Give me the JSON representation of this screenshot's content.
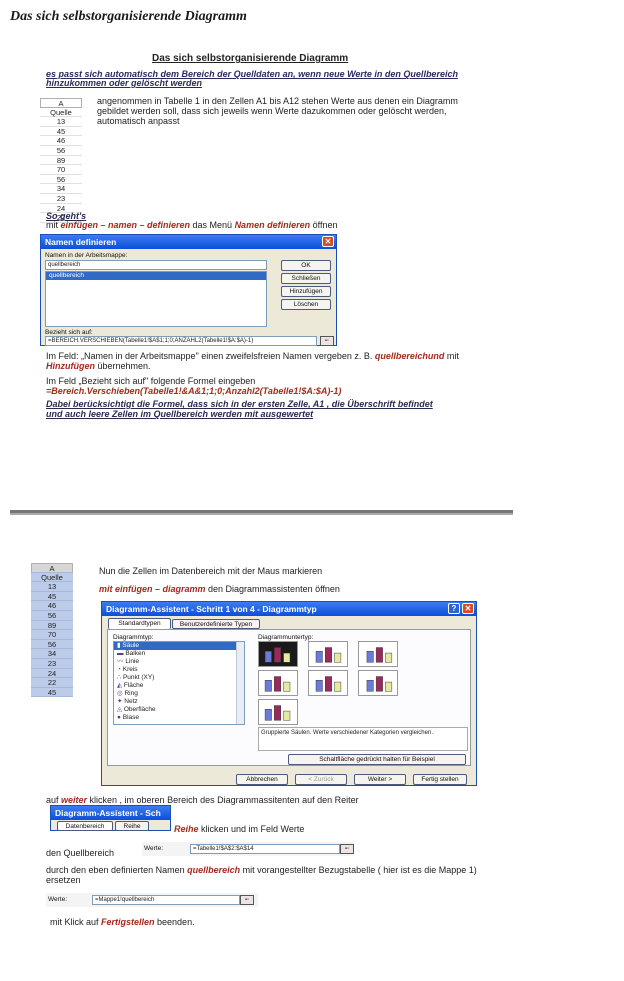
{
  "page_title": "Das sich selbstorganisierende Diagramm",
  "section_title": "Das sich selbstorganisierende Diagramm",
  "intro": "es passt sich automatisch dem Bereich der Quelldaten an, wenn neue Werte in den Quellbereich hinzukommen oder gelöscht werden",
  "sheet1": {
    "header": "A",
    "cells": [
      "Quelle",
      "13",
      "45",
      "46",
      "56",
      "89",
      "70",
      "56",
      "34",
      "23",
      "24",
      "22"
    ]
  },
  "sheet1_text": "angenommen in Tabelle 1 in den Zellen A1 bis A12 stehen Werte aus denen ein Diagramm gebildet werden soll, dass sich jeweils wenn  Werte dazukommen oder gelöscht werden, automatisch anpasst",
  "howto": {
    "heading": "So geht's",
    "pre": "mit ",
    "menu_path": "einfügen – namen – definieren",
    "mid": " das Menü ",
    "menu_name": "Namen definieren",
    "post": " öffnen"
  },
  "names_dialog": {
    "title": "Namen definieren",
    "label_names": "Namen in der Arbeitsmappe:",
    "name_value": "quellbereich",
    "list_items": [
      "quellbereich"
    ],
    "buttons": [
      "OK",
      "Schließen",
      "Hinzufügen",
      "Löschen"
    ],
    "label_ref": "Bezieht sich auf:",
    "ref_value": "=BEREICH.VERSCHIEBEN(Tabelle1!$A$1;1;0;ANZAHL2(Tabelle1!$A:$A)-1)"
  },
  "para1": {
    "text": "Im Feld: „Namen in der Arbeitsmappe\"  einen zweifelsfreien Namen vergeben z. B. ",
    "name": "quellbereichund",
    "mid": " mit ",
    "action": "Hinzufügen",
    "post": " übernehmen."
  },
  "para2": {
    "text": "Im Feld „Bezieht sich auf\" folgende Formel eingeben",
    "formula": "=Bereich.Verschieben(Tabelle1!&A&1;1;0;Anzahl2(Tabelle1!$A:$A)-1)"
  },
  "note": "Dabei berücksichtigt die Formel, dass sich in der ersten Zelle, A1 , die Überschrift befindet und auch leere Zellen im Quellbereich werden mit ausgewertet",
  "sheet2": {
    "header": "A",
    "cells": [
      "Quelle",
      "13",
      "45",
      "46",
      "56",
      "89",
      "70",
      "56",
      "34",
      "23",
      "24",
      "22",
      "45"
    ]
  },
  "step_mark": "Nun die Zellen im Datenbereich mit der Maus markieren",
  "step_open": {
    "path": "mit einfügen – diagramm",
    "text": " den Diagrammassistenten öffnen"
  },
  "wizard": {
    "title": "Diagramm-Assistent - Schritt 1 von 4 - Diagrammtyp",
    "tabs": [
      "Standardtypen",
      "Benutzerdefinierte Typen"
    ],
    "label_type": "Diagrammtyp:",
    "label_subtype": "Diagrammuntertyp:",
    "types": [
      "Säule",
      "Balken",
      "Linie",
      "Kreis",
      "Punkt (XY)",
      "Fläche",
      "Ring",
      "Netz",
      "Oberfläche",
      "Blase"
    ],
    "description": "Gruppierte Säulen. Werte verschiedener Kategorien vergleichen.",
    "preview_button": "Schaltfläche gedrückt halten für Beispiel",
    "buttons": [
      "Abbrechen",
      "< Zurück",
      "Weiter >",
      "Fertig stellen"
    ]
  },
  "step_weiter": {
    "pre": "auf ",
    "word": "weiter",
    "post": " klicken , im oberen Bereich des Diagrammassitenten auf den Reiter"
  },
  "mini_wizard": {
    "title": "Diagramm-Assistent - Sch",
    "tabs": [
      "Datenbereich",
      "Reihe"
    ]
  },
  "step_reihe": {
    "word": "Reihe",
    "post": " klicken und im Feld Werte"
  },
  "werte1": {
    "label": "Werte:",
    "value": "=Tabelle1!$A$2:$A$14",
    "prefix": "den Quellbereich"
  },
  "step_replace": {
    "pre": "durch den eben definierten Namen ",
    "name": "quellbereich",
    "post": " mit vorangestellter Bezugstabelle ( hier ist es die Mappe 1) ersetzen"
  },
  "werte2": {
    "label": "Werte:",
    "value": "=Mappe1!quellbereich"
  },
  "step_finish": {
    "pre": "mit Klick auf ",
    "word": "Fertigstellen",
    "post": " beenden."
  },
  "colors": {
    "accent_red": "#a32a1c",
    "xp_blue": "#0a4fd8",
    "selection": "#316ac5"
  }
}
